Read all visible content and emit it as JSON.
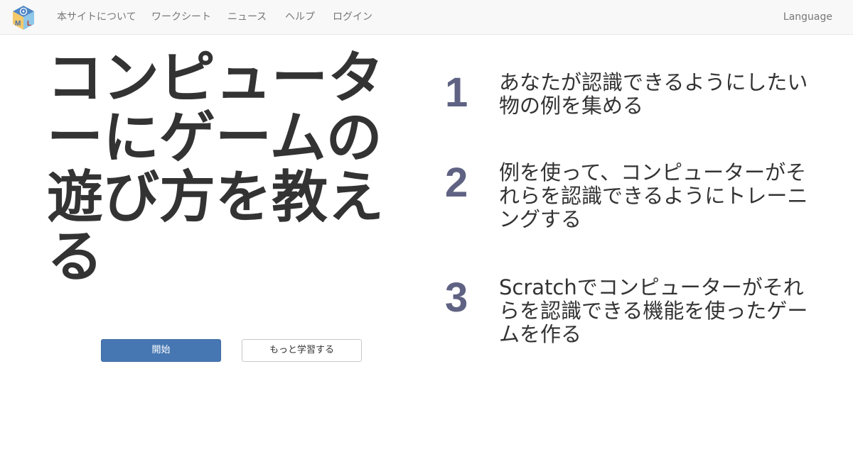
{
  "nav": {
    "items": [
      "本サイトについて",
      "ワークシート",
      "ニュース",
      "ヘルプ",
      "ログイン"
    ],
    "language": "Language",
    "logo_letters": [
      "M",
      "L"
    ]
  },
  "hero": {
    "title": "コンピューターにゲームの遊び方を教える",
    "start_button": "開始",
    "learn_button": "もっと学習する"
  },
  "steps": [
    {
      "number": "1",
      "text": "あなたが認識できるようにしたい物の例を集める"
    },
    {
      "number": "2",
      "text": "例を使って、コンピューターがそれらを認識できるようにトレーニングする"
    },
    {
      "number": "3",
      "text": "Scratchでコンピューターがそれらを認識できる機能を使ったゲームを作る"
    }
  ],
  "colors": {
    "primary_button": "#4677b3",
    "step_number": "#5f6282",
    "navbar_bg": "#f8f8f8"
  }
}
